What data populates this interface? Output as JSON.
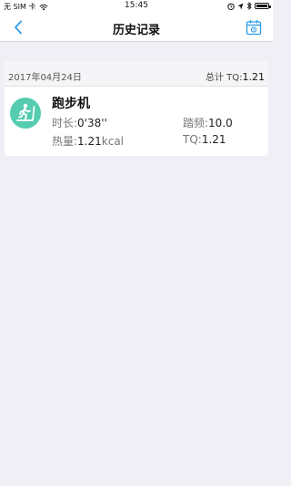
{
  "status_bar": {
    "carrier": "无 SIM 卡",
    "time": "15:45",
    "icons": [
      "wifi-icon",
      "alarm-icon",
      "location-icon",
      "bluetooth-icon",
      "battery-icon"
    ]
  },
  "nav": {
    "title": "历史记录",
    "back_icon": "chevron-left-icon",
    "calendar_icon": "calendar-icon",
    "accent": "#2b9ce6"
  },
  "record": {
    "date": "2017年04月24日",
    "total_label": "总计 TQ:",
    "total_value": "1.21",
    "activity": {
      "name": "跑步机",
      "icon": "treadmill-icon",
      "icon_color": "#55ccb0"
    },
    "stats": {
      "duration_label": "时长:",
      "duration_value": "0'38''",
      "cadence_label": "踏频:",
      "cadence_value": "10.0",
      "calories_label": "热量:",
      "calories_value": "1.21",
      "calories_unit": "kcal",
      "tq_label": "TQ:",
      "tq_value": "1.21"
    }
  }
}
